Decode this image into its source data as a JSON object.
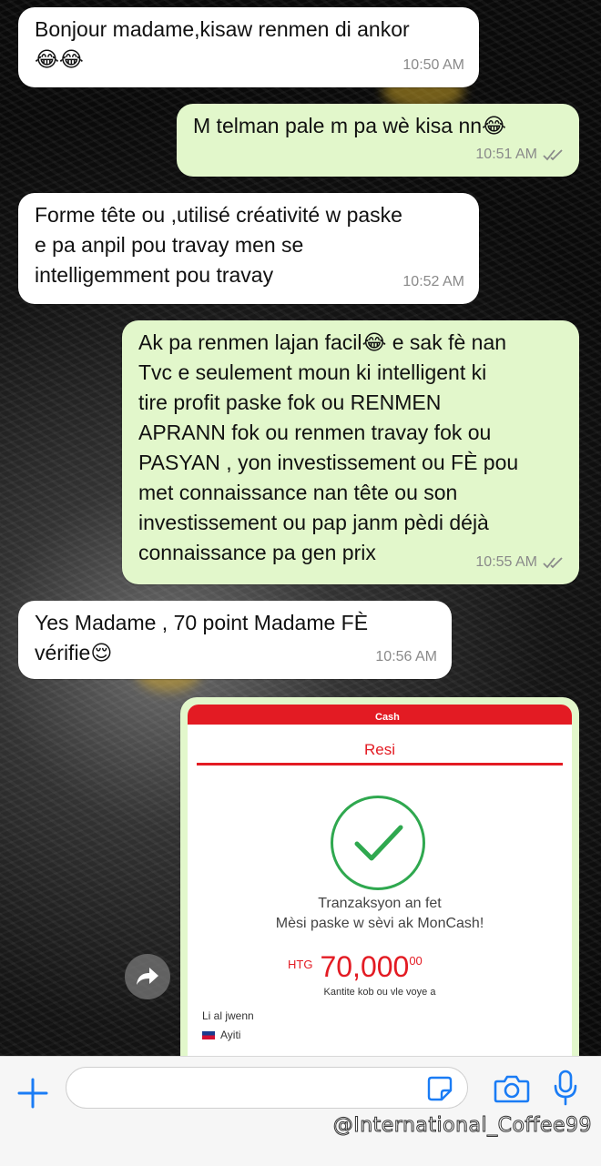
{
  "chat": {
    "messages": [
      {
        "direction": "in",
        "text": "Bonjour madame,kisaw renmen di ankor\n😂😂",
        "time": "10:50 AM"
      },
      {
        "direction": "out",
        "text": "M telman pale m pa wè kisa nn😂",
        "time": "10:51 AM",
        "status": "read"
      },
      {
        "direction": "in",
        "text": "Forme tête ou ,utilisé créativité w paske\ne pa anpil pou travay men se\nintelligemment pou travay",
        "time": "10:52 AM"
      },
      {
        "direction": "out",
        "text": "Ak pa renmen lajan facil😂 e sak fè nan\nTvc e seulement moun ki intelligent ki\ntire profit paske fok ou RENMEN\nAPRANN fok ou renmen travay fok ou\nPASYAN , yon investissement ou FÈ pou\nmet connaissance nan tête ou son\ninvestissement ou pap janm pèdi déjà\nconnaissance pa gen prix",
        "time": "10:55 AM",
        "status": "read"
      },
      {
        "direction": "in",
        "text": "Yes Madame , 70 point Madame FÈ\nvérifie😌",
        "time": "10:56 AM"
      }
    ]
  },
  "receipt": {
    "brand": "Cash",
    "title": "Resi",
    "line1": "Tranzaksyon an fet",
    "line2": "Mèsi paske w sèvi ak MonCash!",
    "currency": "HTG",
    "amount": "70,000",
    "cents": "00",
    "amount_caption": "Kantite kob ou vle voye a",
    "recipient_label": "Li al jwenn",
    "country": "Ayiti",
    "accent_color": "#e31b23",
    "check_color": "#2fa84f"
  },
  "composer": {
    "placeholder": "",
    "icons": [
      "plus-icon",
      "sticker-icon",
      "camera-icon",
      "mic-icon"
    ]
  },
  "watermark": "@International_Coffee99",
  "colors": {
    "incoming_bubble": "#ffffff",
    "outgoing_bubble": "#e2f7cb",
    "read_ticks": "#8a8a8a"
  }
}
